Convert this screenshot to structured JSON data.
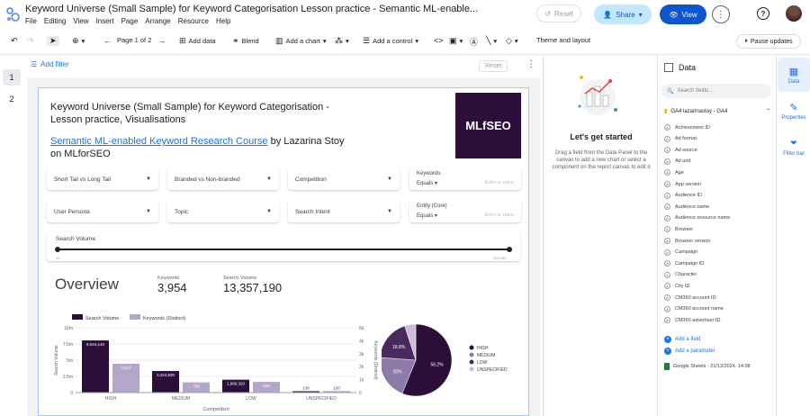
{
  "window": {
    "title": "Keyword Universe (Small Sample) for Keyword Categorisation Lesson practice - Semantic ML-enable...",
    "menu": [
      "File",
      "Editing",
      "View",
      "Insert",
      "Page",
      "Arrange",
      "Resource",
      "Help"
    ],
    "reset_label": "Reset",
    "share_label": "Share",
    "view_label": "View"
  },
  "toolbar": {
    "page_label": "Page 1 of 2",
    "add_data": "Add data",
    "blend": "Blend",
    "add_chart": "Add a chart",
    "add_control": "Add a control",
    "theme_layout": "Theme and layout",
    "pause_updates": "Pause updates"
  },
  "pages": [
    "1",
    "2"
  ],
  "filterbar": {
    "add_filter": "Add filter",
    "reset": "Reset"
  },
  "report": {
    "title": "Keyword Universe (Small Sample) for Keyword Categorisation - Lesson practice, Visualisations",
    "course_link": "Semantic ML-enabled Keyword Research Course",
    "course_suffix": " by Lazarina Stoy on MLforSEO",
    "logo_text": "MLfSEO",
    "controls_row1": [
      "Short Tail vs Long Tail",
      "Branded vs Non-branded",
      "Competition"
    ],
    "controls_row2": [
      "User Persona",
      "Topic",
      "Search Intent"
    ],
    "keywords_input": {
      "label": "Keywords",
      "op": "Equals",
      "placeholder": "Enter a value"
    },
    "entity_input": {
      "label": "Entity (Core)",
      "op": "Equals",
      "placeholder": "Enter a value"
    },
    "slider": {
      "label": "Search Volume",
      "min": "10",
      "max": "100,000"
    },
    "overview": "Overview",
    "scorecards": [
      {
        "label": "Keywords",
        "value": "3,954"
      },
      {
        "label": "Search Volume",
        "value": "13,357,190"
      }
    ]
  },
  "chart_data": [
    {
      "type": "bar",
      "categories": [
        "HIGH",
        "MEDIUM",
        "LOW",
        "UNSPECIFIED"
      ],
      "series": [
        {
          "name": "Search Volume",
          "values": [
            8044140,
            3324930,
            1986320,
            130
          ]
        },
        {
          "name": "Keywords (Distinct)",
          "values": [
            2221,
            789,
            825,
            120
          ]
        }
      ],
      "value_labels": [
        [
          "8,044,140",
          "3,324,930",
          "1,986,320",
          "130"
        ],
        [
          "2,221",
          "789",
          "825",
          "120"
        ]
      ],
      "y_ticks_left": [
        "0",
        "2.5m",
        "5m",
        "7.5m",
        "10m"
      ],
      "y_ticks_right": [
        "0",
        "1k",
        "2k",
        "3k",
        "4k",
        "5k"
      ],
      "xlabel": "Competition",
      "ylabel": "Search Volume",
      "ylabel_right": "Keywords (Distinct)",
      "colors": [
        "#2b0f3a",
        "#b4a7c9"
      ]
    },
    {
      "type": "pie",
      "categories": [
        "HIGH",
        "MEDIUM",
        "LOW",
        "UNSPECIFIED"
      ],
      "values": [
        56.2,
        20.0,
        18.8,
        5.0
      ],
      "labels": [
        "56.2%",
        "20%",
        "18.8%"
      ],
      "colors": [
        "#2b0f3a",
        "#8e7aa8",
        "#4a2a5e",
        "#c9bfd8"
      ]
    }
  ],
  "side": {
    "get_started_title": "Let's get started",
    "get_started_desc": "Drag a field from the Data Panel to the canvas to add a new chart or select a component on the report canvas to edit it",
    "data_title": "Data",
    "search_placeholder": "Search fields...",
    "source": "GA4 lazarinastoy - GA4",
    "fields": [
      "Achievement ID",
      "Ad format",
      "Ad source",
      "Ad unit",
      "Age",
      "App version",
      "Audience ID",
      "Audience name",
      "Audience resource name",
      "Browser",
      "Browser version",
      "Campaign",
      "Campaign ID",
      "Character",
      "City ID",
      "CM360 account ID",
      "CM360 account name",
      "CM360 advertiser ID"
    ],
    "add_field": "Add a field",
    "add_parameter": "Add a parameter",
    "sheet_source": "Google Sheets - 21/12/2024, 14:08",
    "tabs": [
      "Data",
      "Properties",
      "Filter bar"
    ]
  }
}
